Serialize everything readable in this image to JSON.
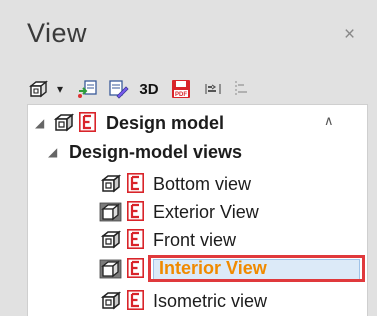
{
  "panel": {
    "title": "View",
    "close_glyph": "×"
  },
  "toolbar": {
    "items": [
      {
        "name": "model-view-icon",
        "glyph": "cube"
      },
      {
        "name": "dropdown-arrow-icon",
        "glyph": "▾"
      },
      {
        "name": "add-view-icon",
        "glyph": "add"
      },
      {
        "name": "edit-view-icon",
        "glyph": "edit"
      },
      {
        "name": "3d-button",
        "label": "3D"
      },
      {
        "name": "save-pdf-icon",
        "label": "PDF"
      },
      {
        "name": "align-icon",
        "glyph": "align"
      },
      {
        "name": "align-disabled-icon",
        "glyph": "align-gray"
      }
    ]
  },
  "tree": {
    "items": [
      {
        "label": "Design model",
        "bold": true,
        "expanded": true,
        "icons": [
          "cube-icon",
          "e-icon"
        ]
      },
      {
        "label": "Design-model views",
        "bold": true,
        "expanded": true,
        "icons": []
      },
      {
        "label": "Bottom view",
        "bold": false,
        "icons": [
          "cube-icon",
          "e-icon"
        ]
      },
      {
        "label": "Exterior View",
        "bold": false,
        "icons": [
          "camera-icon",
          "e-icon"
        ]
      },
      {
        "label": "Front view",
        "bold": false,
        "icons": [
          "cube-icon",
          "e-icon"
        ]
      },
      {
        "label": "Interior View",
        "bold": true,
        "selected": true,
        "icons": [
          "camera-icon",
          "e-icon"
        ]
      },
      {
        "label": "Isometric view",
        "bold": false,
        "icons": [
          "cube-icon",
          "e-icon"
        ]
      }
    ]
  },
  "colors": {
    "panel_bg": "#e1e1e1",
    "selection_border": "#e0393c",
    "selection_fill": "#dceaf8",
    "selected_text": "#f08a00",
    "e_icon_red": "#d9242a"
  }
}
